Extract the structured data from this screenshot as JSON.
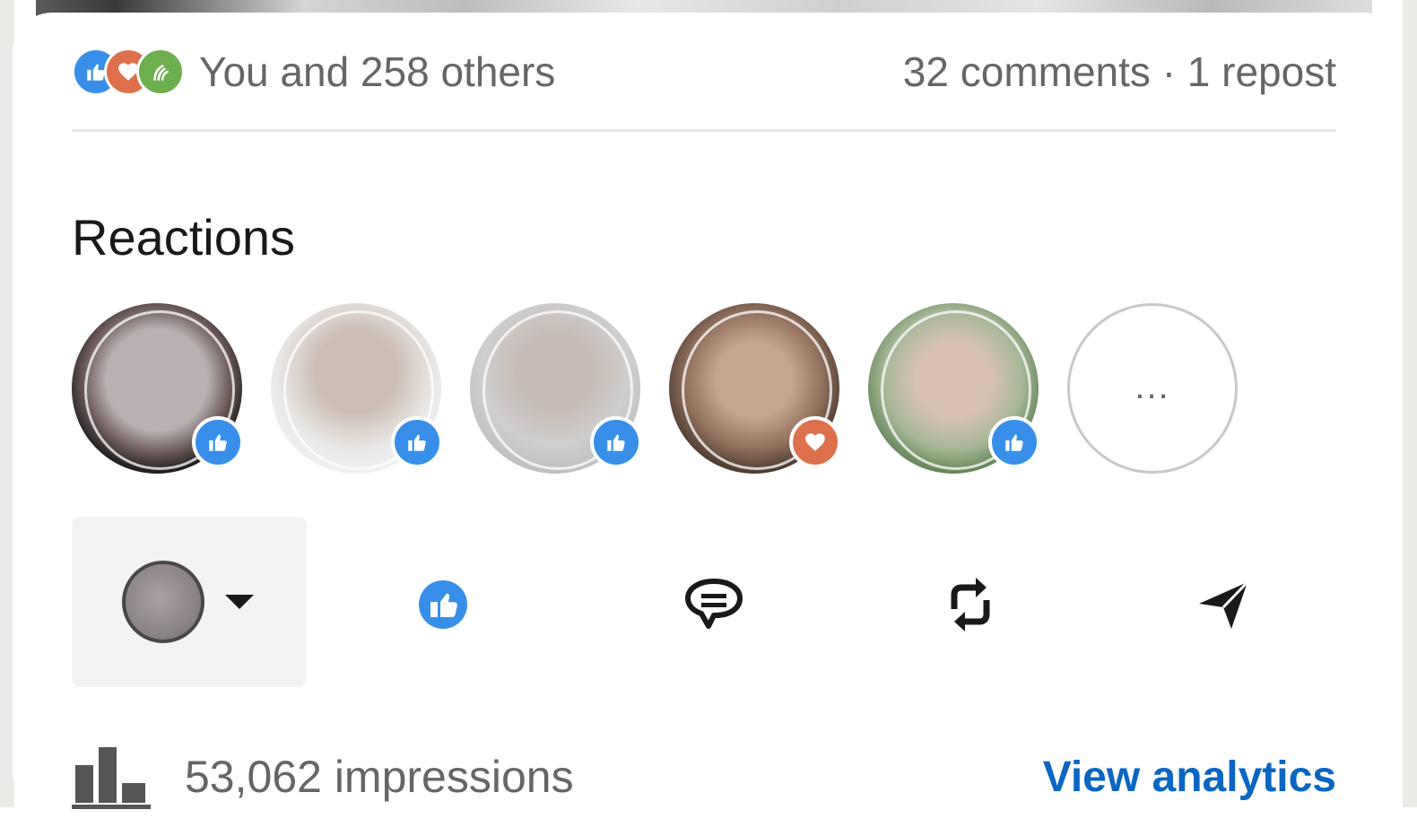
{
  "social_counts": {
    "reactors_text": "You and 258 others",
    "comments_reposts": "32 comments · 1 repost",
    "reaction_types": [
      "like",
      "love",
      "support"
    ]
  },
  "reactions_section": {
    "title": "Reactions",
    "avatars": [
      {
        "reaction": "like"
      },
      {
        "reaction": "like"
      },
      {
        "reaction": "like"
      },
      {
        "reaction": "love"
      },
      {
        "reaction": "like"
      }
    ],
    "more_label": "..."
  },
  "actions": {
    "items": [
      "identity-selector",
      "like",
      "comment",
      "repost",
      "send"
    ]
  },
  "analytics": {
    "impressions": "53,062 impressions",
    "view_analytics": "View analytics"
  },
  "colors": {
    "like": "#378fe9",
    "love": "#df704d",
    "support": "#6dae4f",
    "link": "#0a66c2",
    "muted_text": "#666666"
  }
}
